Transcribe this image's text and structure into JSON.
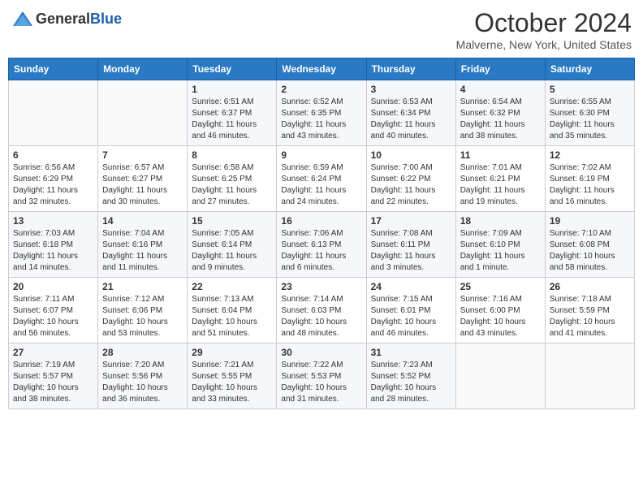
{
  "logo": {
    "general": "General",
    "blue": "Blue"
  },
  "header": {
    "month": "October 2024",
    "location": "Malverne, New York, United States"
  },
  "weekdays": [
    "Sunday",
    "Monday",
    "Tuesday",
    "Wednesday",
    "Thursday",
    "Friday",
    "Saturday"
  ],
  "weeks": [
    [
      {
        "day": "",
        "info": ""
      },
      {
        "day": "",
        "info": ""
      },
      {
        "day": "1",
        "info": "Sunrise: 6:51 AM\nSunset: 6:37 PM\nDaylight: 11 hours and 46 minutes."
      },
      {
        "day": "2",
        "info": "Sunrise: 6:52 AM\nSunset: 6:35 PM\nDaylight: 11 hours and 43 minutes."
      },
      {
        "day": "3",
        "info": "Sunrise: 6:53 AM\nSunset: 6:34 PM\nDaylight: 11 hours and 40 minutes."
      },
      {
        "day": "4",
        "info": "Sunrise: 6:54 AM\nSunset: 6:32 PM\nDaylight: 11 hours and 38 minutes."
      },
      {
        "day": "5",
        "info": "Sunrise: 6:55 AM\nSunset: 6:30 PM\nDaylight: 11 hours and 35 minutes."
      }
    ],
    [
      {
        "day": "6",
        "info": "Sunrise: 6:56 AM\nSunset: 6:29 PM\nDaylight: 11 hours and 32 minutes."
      },
      {
        "day": "7",
        "info": "Sunrise: 6:57 AM\nSunset: 6:27 PM\nDaylight: 11 hours and 30 minutes."
      },
      {
        "day": "8",
        "info": "Sunrise: 6:58 AM\nSunset: 6:25 PM\nDaylight: 11 hours and 27 minutes."
      },
      {
        "day": "9",
        "info": "Sunrise: 6:59 AM\nSunset: 6:24 PM\nDaylight: 11 hours and 24 minutes."
      },
      {
        "day": "10",
        "info": "Sunrise: 7:00 AM\nSunset: 6:22 PM\nDaylight: 11 hours and 22 minutes."
      },
      {
        "day": "11",
        "info": "Sunrise: 7:01 AM\nSunset: 6:21 PM\nDaylight: 11 hours and 19 minutes."
      },
      {
        "day": "12",
        "info": "Sunrise: 7:02 AM\nSunset: 6:19 PM\nDaylight: 11 hours and 16 minutes."
      }
    ],
    [
      {
        "day": "13",
        "info": "Sunrise: 7:03 AM\nSunset: 6:18 PM\nDaylight: 11 hours and 14 minutes."
      },
      {
        "day": "14",
        "info": "Sunrise: 7:04 AM\nSunset: 6:16 PM\nDaylight: 11 hours and 11 minutes."
      },
      {
        "day": "15",
        "info": "Sunrise: 7:05 AM\nSunset: 6:14 PM\nDaylight: 11 hours and 9 minutes."
      },
      {
        "day": "16",
        "info": "Sunrise: 7:06 AM\nSunset: 6:13 PM\nDaylight: 11 hours and 6 minutes."
      },
      {
        "day": "17",
        "info": "Sunrise: 7:08 AM\nSunset: 6:11 PM\nDaylight: 11 hours and 3 minutes."
      },
      {
        "day": "18",
        "info": "Sunrise: 7:09 AM\nSunset: 6:10 PM\nDaylight: 11 hours and 1 minute."
      },
      {
        "day": "19",
        "info": "Sunrise: 7:10 AM\nSunset: 6:08 PM\nDaylight: 10 hours and 58 minutes."
      }
    ],
    [
      {
        "day": "20",
        "info": "Sunrise: 7:11 AM\nSunset: 6:07 PM\nDaylight: 10 hours and 56 minutes."
      },
      {
        "day": "21",
        "info": "Sunrise: 7:12 AM\nSunset: 6:06 PM\nDaylight: 10 hours and 53 minutes."
      },
      {
        "day": "22",
        "info": "Sunrise: 7:13 AM\nSunset: 6:04 PM\nDaylight: 10 hours and 51 minutes."
      },
      {
        "day": "23",
        "info": "Sunrise: 7:14 AM\nSunset: 6:03 PM\nDaylight: 10 hours and 48 minutes."
      },
      {
        "day": "24",
        "info": "Sunrise: 7:15 AM\nSunset: 6:01 PM\nDaylight: 10 hours and 46 minutes."
      },
      {
        "day": "25",
        "info": "Sunrise: 7:16 AM\nSunset: 6:00 PM\nDaylight: 10 hours and 43 minutes."
      },
      {
        "day": "26",
        "info": "Sunrise: 7:18 AM\nSunset: 5:59 PM\nDaylight: 10 hours and 41 minutes."
      }
    ],
    [
      {
        "day": "27",
        "info": "Sunrise: 7:19 AM\nSunset: 5:57 PM\nDaylight: 10 hours and 38 minutes."
      },
      {
        "day": "28",
        "info": "Sunrise: 7:20 AM\nSunset: 5:56 PM\nDaylight: 10 hours and 36 minutes."
      },
      {
        "day": "29",
        "info": "Sunrise: 7:21 AM\nSunset: 5:55 PM\nDaylight: 10 hours and 33 minutes."
      },
      {
        "day": "30",
        "info": "Sunrise: 7:22 AM\nSunset: 5:53 PM\nDaylight: 10 hours and 31 minutes."
      },
      {
        "day": "31",
        "info": "Sunrise: 7:23 AM\nSunset: 5:52 PM\nDaylight: 10 hours and 28 minutes."
      },
      {
        "day": "",
        "info": ""
      },
      {
        "day": "",
        "info": ""
      }
    ]
  ]
}
